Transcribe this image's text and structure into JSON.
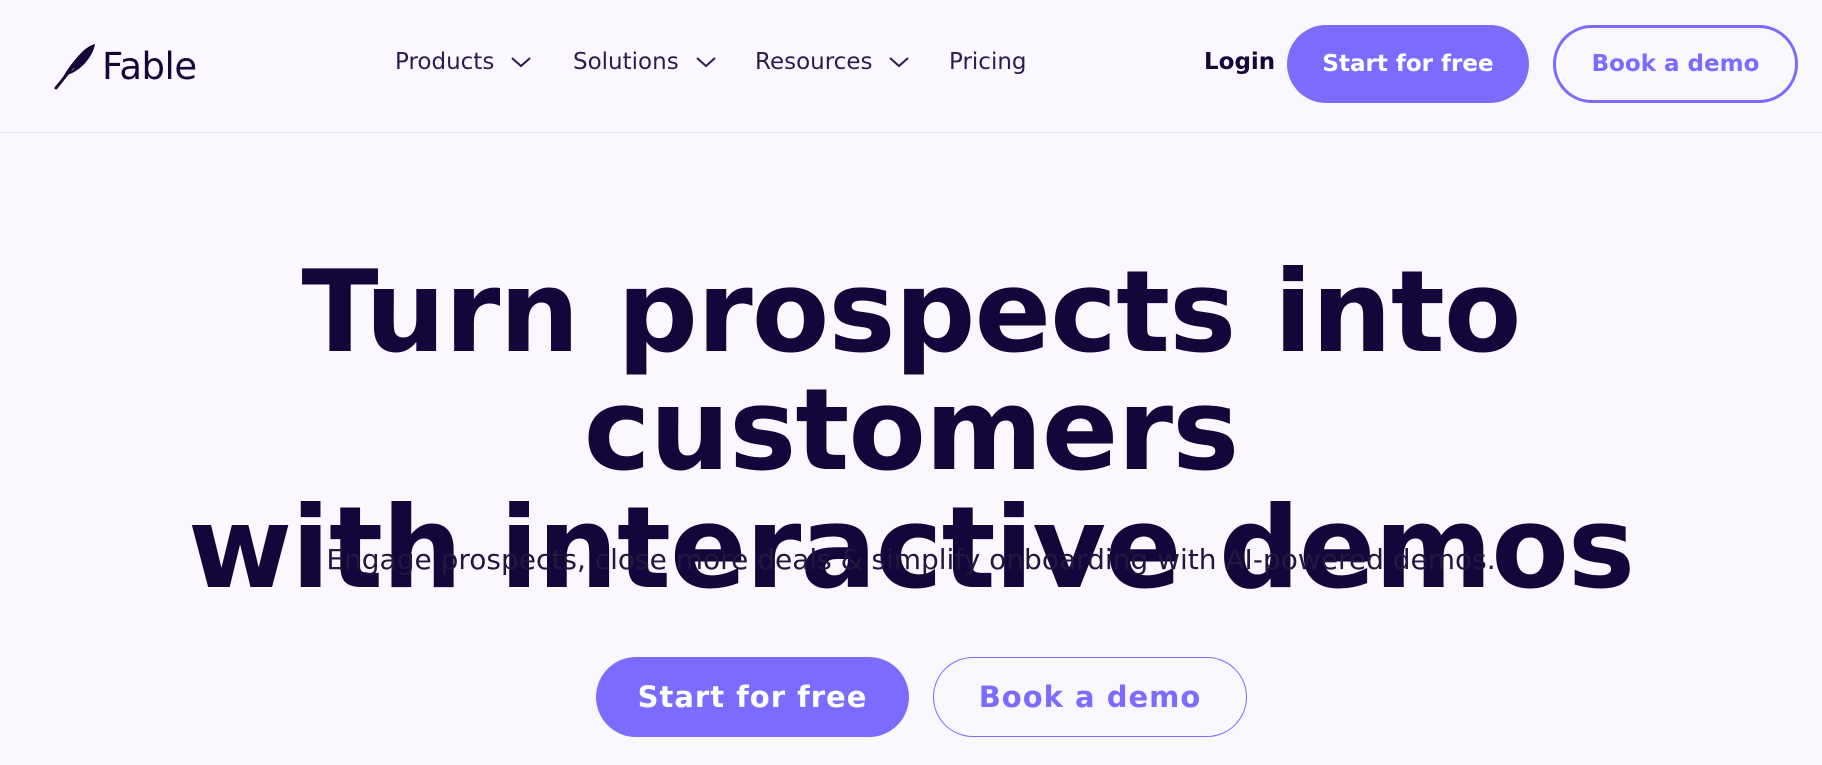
{
  "brand": {
    "name": "Fable",
    "icon": "feather-icon",
    "text_color": "#160638"
  },
  "nav": {
    "items": [
      {
        "label": "Products",
        "has_dropdown": true
      },
      {
        "label": "Solutions",
        "has_dropdown": true
      },
      {
        "label": "Resources",
        "has_dropdown": true
      },
      {
        "label": "Pricing",
        "has_dropdown": false
      }
    ],
    "login_label": "Login",
    "start_label": "Start for free",
    "demo_label": "Book a demo"
  },
  "hero": {
    "title_line1": "Turn prospects into customers",
    "title_line2": "with interactive demos",
    "subtitle": "Engage prospects, close more deals & simplify onboarding with AI-powered demos.",
    "primary_cta": "Start for free",
    "secondary_cta": "Book a demo"
  },
  "colors": {
    "accent": "#7b6cff",
    "background": "#fbf7fe",
    "heading": "#14053a"
  }
}
